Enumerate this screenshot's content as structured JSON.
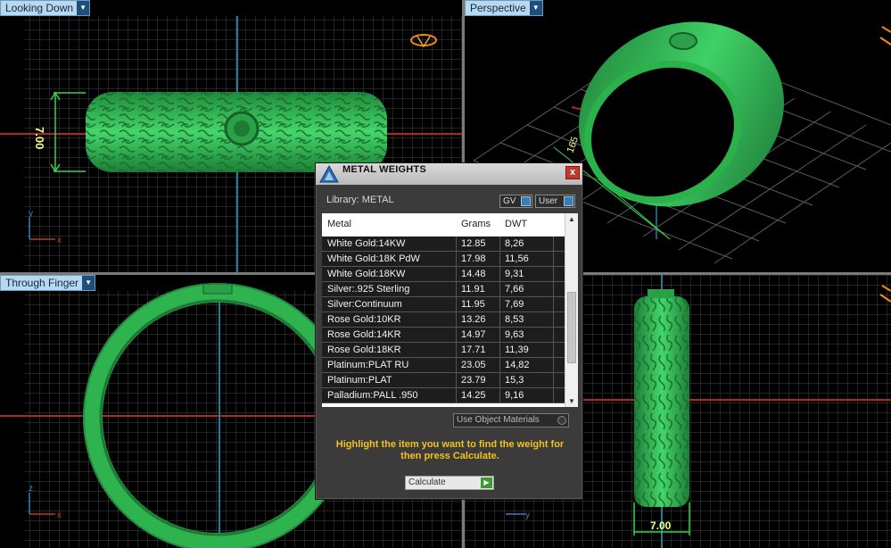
{
  "viewports": {
    "top_left": {
      "label": "Looking Down"
    },
    "top_right": {
      "label": "Perspective"
    },
    "bottom_left": {
      "label": "Through Finger"
    }
  },
  "dimensions": {
    "height_value": "7.00",
    "width_value": "7.00",
    "perspective_value": "165"
  },
  "dialog": {
    "title": "METAL WEIGHTS",
    "close_label": "x",
    "library_label": "Library: METAL",
    "gv_label": "GV",
    "user_label": "User",
    "columns": [
      "Metal",
      "Grams",
      "DWT"
    ],
    "rows": [
      {
        "metal": "White Gold:14KW",
        "grams": "12.85",
        "dwt": "8,26"
      },
      {
        "metal": "White Gold:18K PdW",
        "grams": "17.98",
        "dwt": "11,56"
      },
      {
        "metal": "White Gold:18KW",
        "grams": "14.48",
        "dwt": "9,31"
      },
      {
        "metal": "Silver:.925 Sterling",
        "grams": "11.91",
        "dwt": "7,66"
      },
      {
        "metal": "Silver:Continuum",
        "grams": "11.95",
        "dwt": "7,69"
      },
      {
        "metal": "Rose Gold:10KR",
        "grams": "13.26",
        "dwt": "8,53"
      },
      {
        "metal": "Rose Gold:14KR",
        "grams": "14.97",
        "dwt": "9,63"
      },
      {
        "metal": "Rose Gold:18KR",
        "grams": "17.71",
        "dwt": "11,39"
      },
      {
        "metal": "Platinum:PLAT RU",
        "grams": "23.05",
        "dwt": "14,82"
      },
      {
        "metal": "Platinum:PLAT",
        "grams": "23.79",
        "dwt": "15,3"
      },
      {
        "metal": "Palladium:PALL .950",
        "grams": "14.25",
        "dwt": "9,16"
      }
    ],
    "use_object_materials_label": "Use Object Materials",
    "hint": "Highlight the item you want to find the weight for then press Calculate.",
    "calculate_label": "Calculate"
  },
  "axes": {
    "x": "x",
    "y": "y",
    "z": "z"
  },
  "colors": {
    "ring": "#2fb34f",
    "grid": "#4a4a4a",
    "tab_bg": "#b8d8ef",
    "hint": "#f3c21c"
  }
}
